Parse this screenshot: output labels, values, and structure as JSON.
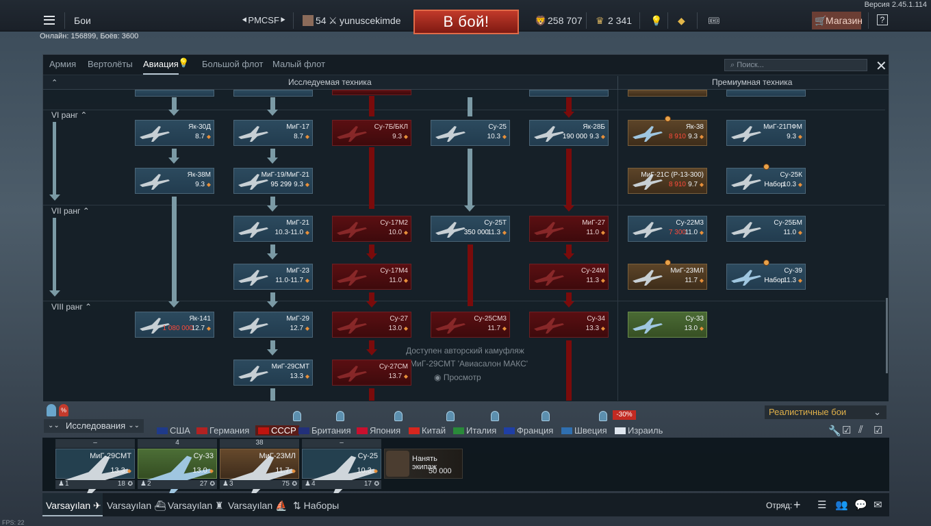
{
  "version": "Версия 2.45.1.114",
  "topbar": {
    "menu_icon": "hamburger-icon",
    "battles_label": "Бои",
    "squad_tag": "PMCSF",
    "level": "54",
    "username": "yunuscekimde",
    "battle_button": "В бой!",
    "silver": "258 707",
    "gold": "2 341",
    "shop": "Магазин",
    "help": "?"
  },
  "online": "Онлайн: 156899, Боёв: 3600",
  "tabs": [
    "Армия",
    "Вертолёты",
    "Авиация",
    "Большой флот",
    "Малый флот"
  ],
  "active_tab": "Авиация",
  "search_placeholder": "Поиск...",
  "sections": {
    "research": "Исследуемая техника",
    "premium": "Премиумная техника"
  },
  "ranks": [
    "VI ранг",
    "VII ранг",
    "VIII ранг"
  ],
  "vehicles": [
    {
      "id": "yak30d",
      "name": "Як-30Д",
      "br": "8.7",
      "style": "normal"
    },
    {
      "id": "mig17",
      "name": "МиГ-17",
      "br": "8.7",
      "style": "normal"
    },
    {
      "id": "su7b",
      "name": "Су-7Б/БКЛ",
      "br": "9.3",
      "style": "red"
    },
    {
      "id": "su25",
      "name": "Су-25",
      "br": "10.3",
      "style": "normal"
    },
    {
      "id": "yak28b",
      "name": "Як-28Б",
      "br": "9.3",
      "price": "190 000",
      "style": "normal"
    },
    {
      "id": "yak38",
      "name": "Як-38",
      "br": "9.3",
      "price": "8 910",
      "style": "prem"
    },
    {
      "id": "mig21pfm",
      "name": "МиГ-21ПФМ",
      "br": "9.3",
      "style": "normal"
    },
    {
      "id": "yak38m",
      "name": "Як-38М",
      "br": "9.3",
      "style": "normal"
    },
    {
      "id": "mig19",
      "name": "МиГ-19/МиГ-21",
      "br": "9.3",
      "price": "95 299",
      "style": "normal"
    },
    {
      "id": "mig21s",
      "name": "МиГ-21С (Р-13-300)",
      "br": "9.7",
      "price": "8 910",
      "style": "prem"
    },
    {
      "id": "su25k",
      "name": "Су-25К",
      "br": "10.3",
      "price": "Набор",
      "style": "normal"
    },
    {
      "id": "mig21",
      "name": "МиГ-21",
      "br": "10.3-11.0",
      "style": "normal"
    },
    {
      "id": "su17m2",
      "name": "Су-17М2",
      "br": "10.0",
      "style": "red"
    },
    {
      "id": "su25t",
      "name": "Су-25Т",
      "br": "11.3",
      "price": "350 000",
      "style": "normal"
    },
    {
      "id": "mig27",
      "name": "МиГ-27",
      "br": "11.0",
      "style": "red"
    },
    {
      "id": "su22m3",
      "name": "Су-22М3",
      "br": "11.0",
      "price": "7 300",
      "style": "normal"
    },
    {
      "id": "su25bm",
      "name": "Су-25БМ",
      "br": "11.0",
      "style": "normal"
    },
    {
      "id": "mig23",
      "name": "МиГ-23",
      "br": "11.0-11.7",
      "style": "normal"
    },
    {
      "id": "su17m4",
      "name": "Су-17М4",
      "br": "11.0",
      "style": "red"
    },
    {
      "id": "su24m",
      "name": "Су-24М",
      "br": "11.3",
      "style": "red"
    },
    {
      "id": "mig23ml",
      "name": "МиГ-23МЛ",
      "br": "11.7",
      "style": "prem"
    },
    {
      "id": "su39",
      "name": "Су-39",
      "br": "11.3",
      "price": "Набор",
      "style": "normal"
    },
    {
      "id": "yak141",
      "name": "Як-141",
      "br": "12.7",
      "price": "1 080 000",
      "style": "normal"
    },
    {
      "id": "mig29",
      "name": "МиГ-29",
      "br": "12.7",
      "style": "normal"
    },
    {
      "id": "su27",
      "name": "Су-27",
      "br": "13.0",
      "style": "red"
    },
    {
      "id": "su25sm3",
      "name": "Су-25СМ3",
      "br": "11.7",
      "style": "red"
    },
    {
      "id": "su34",
      "name": "Су-34",
      "br": "13.3",
      "style": "red"
    },
    {
      "id": "su33",
      "name": "Су-33",
      "br": "13.0",
      "style": "green"
    },
    {
      "id": "mig29smt",
      "name": "МиГ-29СМТ",
      "br": "13.3",
      "style": "normal"
    },
    {
      "id": "su27sm",
      "name": "Су-27СМ",
      "br": "13.7",
      "style": "red"
    }
  ],
  "overlay": {
    "camo_available": "Доступен авторский камуфляж",
    "camo_name": "МиГ-29СМТ 'Авиасалон МАКС'",
    "view": "Просмотр"
  },
  "discount": "-30%",
  "research_label": "Исследования",
  "nations": [
    "США",
    "Германия",
    "СССР",
    "Британия",
    "Япония",
    "Китай",
    "Италия",
    "Франция",
    "Швеция",
    "Израиль"
  ],
  "active_nation": "СССР",
  "game_mode": "Реалистичные бои",
  "crew": [
    {
      "name": "МиГ-29СМТ",
      "br": "13.3",
      "top": "–",
      "slot": "1",
      "count": "18",
      "style": "normal"
    },
    {
      "name": "Су-33",
      "br": "13.0",
      "top": "4",
      "slot": "2",
      "count": "27",
      "style": "green"
    },
    {
      "name": "МиГ-23МЛ",
      "br": "11.7",
      "top": "38",
      "slot": "3",
      "count": "75",
      "style": "prem"
    },
    {
      "name": "Су-25",
      "br": "10.3",
      "top": "–",
      "slot": "4",
      "count": "17",
      "style": "normal"
    }
  ],
  "hire_crew": {
    "label": "Нанять экипаж",
    "price": "50 000"
  },
  "presets": [
    "Varsayılan",
    "Varsayılan",
    "Varsayılan",
    "Varsayılan"
  ],
  "presets_sets": "Наборы",
  "squad_label": "Отряд:",
  "fps": "FPS: 22"
}
